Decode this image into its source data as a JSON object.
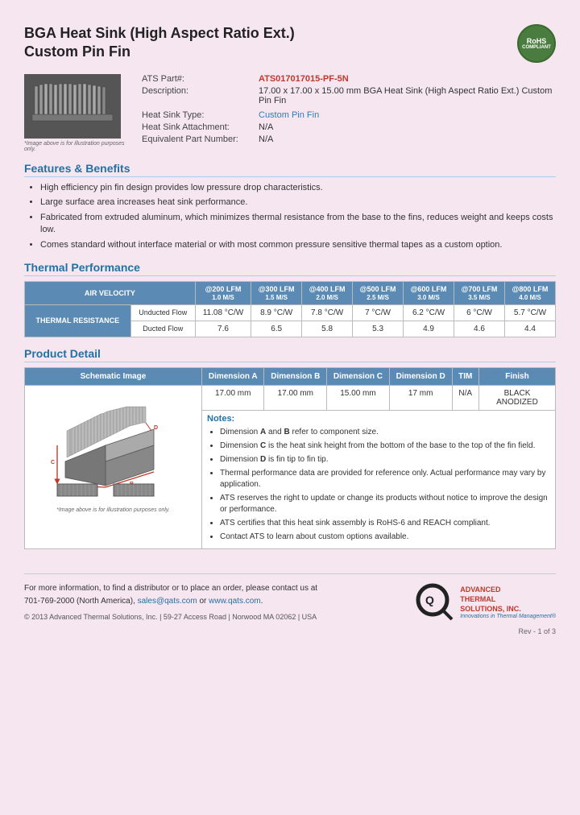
{
  "header": {
    "title_line1": "BGA Heat Sink (High Aspect Ratio Ext.)",
    "title_line2": "Custom Pin Fin",
    "rohs": "RoHS\nCOMPLIANT"
  },
  "specs": {
    "part_label": "ATS Part#:",
    "part_number": "ATS017017015-PF-5N",
    "desc_label": "Description:",
    "description": "17.00 x 17.00 x 15.00 mm BGA Heat Sink (High Aspect Ratio Ext.) Custom Pin Fin",
    "type_label": "Heat Sink Type:",
    "type_value": "Custom Pin Fin",
    "attach_label": "Heat Sink Attachment:",
    "attach_value": "N/A",
    "equiv_label": "Equivalent Part Number:",
    "equiv_value": "N/A"
  },
  "image_caption": "*Image above is for illustration purposes only.",
  "features": {
    "title": "Features & Benefits",
    "items": [
      "High efficiency pin fin design provides low pressure drop characteristics.",
      "Large surface area increases heat sink performance.",
      "Fabricated from extruded aluminum, which minimizes thermal resistance from the base to the fins, reduces weight and keeps costs low.",
      "Comes standard without interface material or with most common pressure sensitive thermal tapes as a custom option."
    ]
  },
  "thermal": {
    "section_title": "Thermal Performance",
    "air_velocity_label": "AIR VELOCITY",
    "columns": [
      {
        "label": "@200 LFM",
        "sub": "1.0 M/S"
      },
      {
        "label": "@300 LFM",
        "sub": "1.5 M/S"
      },
      {
        "label": "@400 LFM",
        "sub": "2.0 M/S"
      },
      {
        "label": "@500 LFM",
        "sub": "2.5 M/S"
      },
      {
        "label": "@600 LFM",
        "sub": "3.0 M/S"
      },
      {
        "label": "@700 LFM",
        "sub": "3.5 M/S"
      },
      {
        "label": "@800 LFM",
        "sub": "4.0 M/S"
      }
    ],
    "row_label": "THERMAL RESISTANCE",
    "rows": [
      {
        "sub_label": "Unducted Flow",
        "values": [
          "11.08 °C/W",
          "8.9 °C/W",
          "7.8 °C/W",
          "7 °C/W",
          "6.2 °C/W",
          "6 °C/W",
          "5.7 °C/W"
        ]
      },
      {
        "sub_label": "Ducted Flow",
        "values": [
          "7.6",
          "6.5",
          "5.8",
          "5.3",
          "4.9",
          "4.6",
          "4.4"
        ]
      }
    ]
  },
  "product_detail": {
    "section_title": "Product Detail",
    "schematic_label": "Schematic Image",
    "schematic_caption": "*Image above is for illustration purposes only.",
    "col_headers": [
      "Dimension A",
      "Dimension B",
      "Dimension C",
      "Dimension D",
      "TIM",
      "Finish"
    ],
    "dim_values": [
      "17.00 mm",
      "17.00 mm",
      "15.00 mm",
      "17 mm",
      "N/A",
      "BLACK ANODIZED"
    ],
    "notes_title": "Notes:",
    "notes": [
      "Dimension A and B refer to component size.",
      "Dimension C is the heat sink height from the bottom of the base to the top of the fin field.",
      "Dimension D is fin tip to fin tip.",
      "Thermal performance data are provided for reference only. Actual performance may vary by application.",
      "ATS reserves the right to update or change its products without notice to improve the design or performance.",
      "ATS certifies that this heat sink assembly is RoHS-6 and REACH compliant.",
      "Contact ATS to learn about custom options available."
    ]
  },
  "footer": {
    "contact_text": "For more information, to find a distributor or to place an order, please contact us at\n701-769-2000 (North America), sales@qats.com or www.qats.com.",
    "copyright": "© 2013 Advanced Thermal Solutions, Inc. | 59-27 Access Road | Norwood MA  02062 | USA",
    "ats_name": "ADVANCED\nTHERMAL\nSOLUTIONS, INC.",
    "ats_tagline": "Innovations in Thermal Management®",
    "page_num": "Rev - 1 of 3"
  }
}
